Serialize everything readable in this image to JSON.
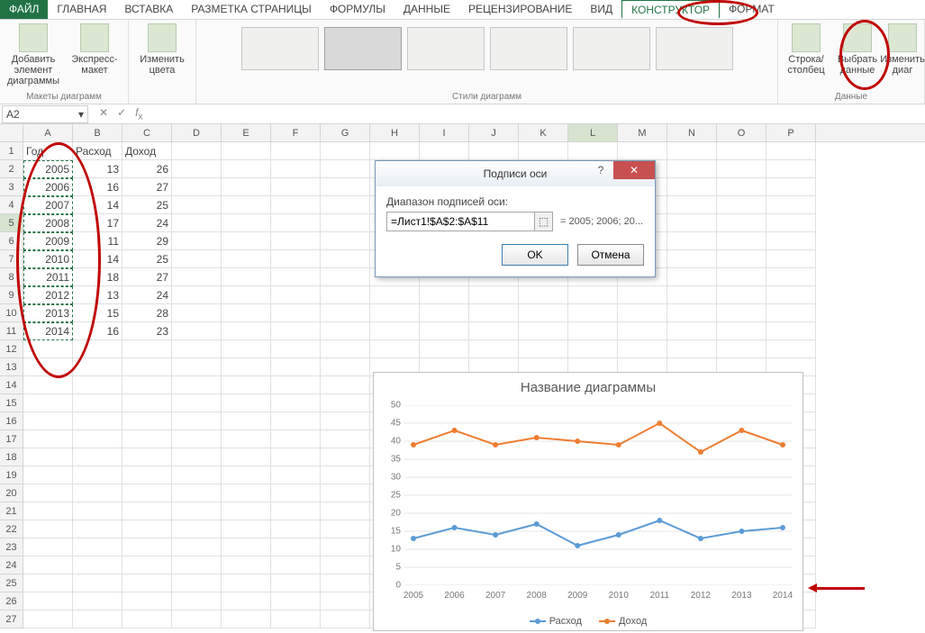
{
  "tabs": {
    "file": "ФАЙЛ",
    "items": [
      "ГЛАВНАЯ",
      "ВСТАВКА",
      "РАЗМЕТКА СТРАНИЦЫ",
      "ФОРМУЛЫ",
      "ДАННЫЕ",
      "РЕЦЕНЗИРОВАНИЕ",
      "ВИД",
      "КОНСТРУКТОР",
      "ФОРМАТ"
    ],
    "active": "КОНСТРУКТОР"
  },
  "ribbon": {
    "g1_add": "Добавить элемент диаграммы",
    "g1_quick": "Экспресс-макет",
    "g1_label": "Макеты диаграмм",
    "g2_colors": "Изменить цвета",
    "g3_label": "Стили диаграмм",
    "g4_rowcol": "Строка/столбец",
    "g4_select": "Выбрать данные",
    "g4_edit": "Изменить диаг",
    "g4_label": "Данные"
  },
  "namebox": "A2",
  "columns": [
    "A",
    "B",
    "C",
    "D",
    "E",
    "F",
    "G",
    "H",
    "I",
    "J",
    "K",
    "L",
    "M",
    "N",
    "O",
    "P"
  ],
  "header_row": [
    "Год",
    "Расход",
    "Доход"
  ],
  "data_rows": [
    [
      "2005",
      "13",
      "26"
    ],
    [
      "2006",
      "16",
      "27"
    ],
    [
      "2007",
      "14",
      "25"
    ],
    [
      "2008",
      "17",
      "24"
    ],
    [
      "2009",
      "11",
      "29"
    ],
    [
      "2010",
      "14",
      "25"
    ],
    [
      "2011",
      "18",
      "27"
    ],
    [
      "2012",
      "13",
      "24"
    ],
    [
      "2013",
      "15",
      "28"
    ],
    [
      "2014",
      "16",
      "23"
    ]
  ],
  "dialog": {
    "title": "Подписи оси",
    "label": "Диапазон подписей оси:",
    "value": "=Лист1!$A$2:$A$11",
    "preview": "= 2005; 2006; 20...",
    "ok": "OK",
    "cancel": "Отмена"
  },
  "chart_data": {
    "type": "line",
    "title": "Название диаграммы",
    "categories": [
      "2005",
      "2006",
      "2007",
      "2008",
      "2009",
      "2010",
      "2011",
      "2012",
      "2013",
      "2014"
    ],
    "series": [
      {
        "name": "Расход",
        "color": "#5b9bd5",
        "values": [
          13,
          16,
          14,
          17,
          11,
          14,
          18,
          13,
          15,
          16
        ]
      },
      {
        "name": "Доход",
        "color": "#ed7d31",
        "values": [
          39,
          43,
          39,
          41,
          40,
          39,
          45,
          37,
          43,
          39
        ]
      }
    ],
    "xlabel": "",
    "ylabel": "",
    "ylim": [
      0,
      50
    ],
    "yticks": [
      0,
      5,
      10,
      15,
      20,
      25,
      30,
      35,
      40,
      45,
      50
    ]
  }
}
